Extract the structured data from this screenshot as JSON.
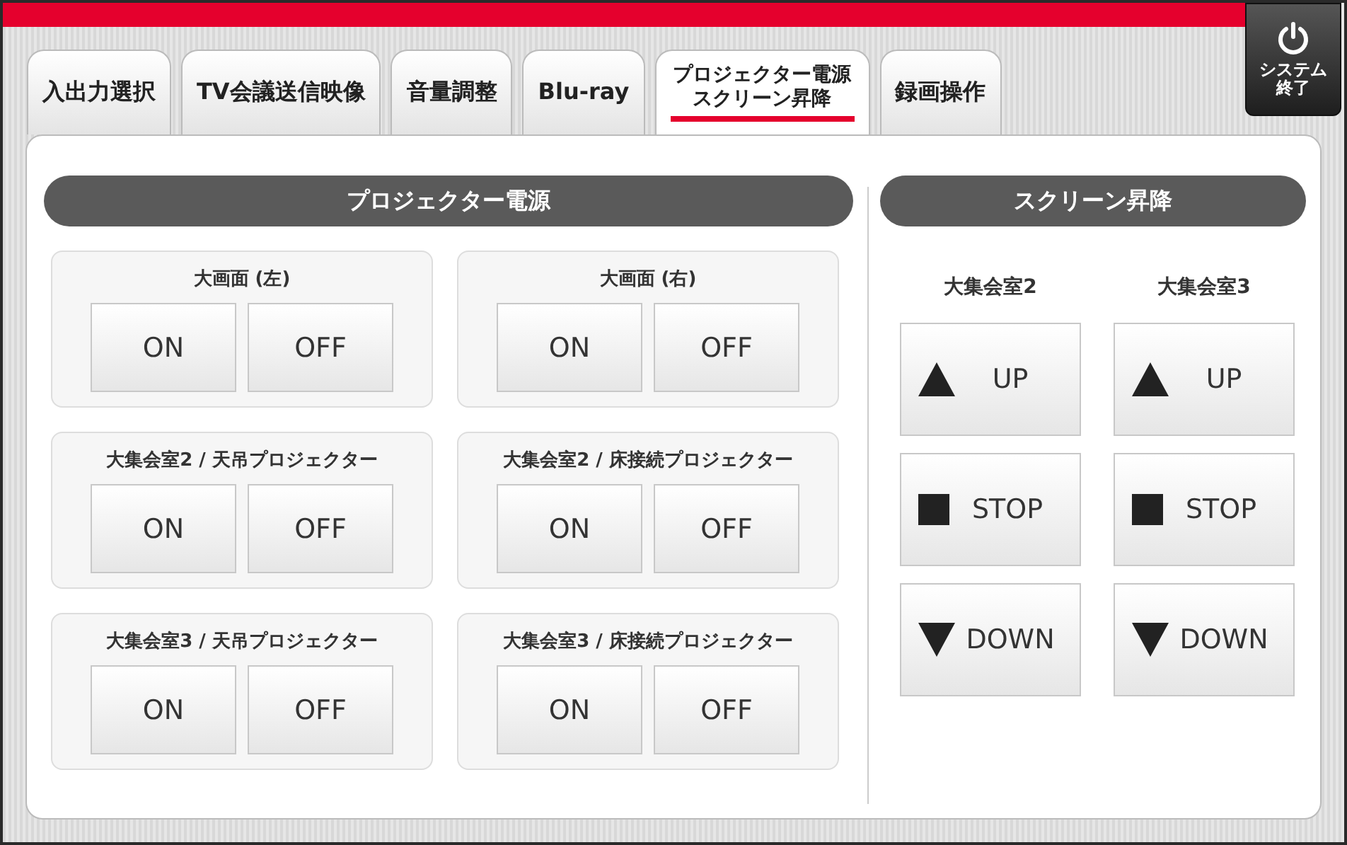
{
  "tabs": [
    {
      "label": "入出力選択",
      "selected": false
    },
    {
      "label": "TV会議送信映像",
      "selected": false
    },
    {
      "label": "音量調整",
      "selected": false
    },
    {
      "label": "Blu-ray",
      "selected": false
    },
    {
      "label": "プロジェクター電源スクリーン昇降",
      "selected": true
    },
    {
      "label": "録画操作",
      "selected": false
    }
  ],
  "system_button": {
    "label": "システム終了"
  },
  "projector_power": {
    "title": "プロジェクター電源",
    "groups": [
      {
        "name": "大画面 (左)",
        "buttons": [
          "ON",
          "OFF"
        ]
      },
      {
        "name": "大画面 (右)",
        "buttons": [
          "ON",
          "OFF"
        ]
      },
      {
        "name": "大集会室2 / 天吊プロジェクター",
        "buttons": [
          "ON",
          "OFF"
        ]
      },
      {
        "name": "大集会室2 / 床接続プロジェクター",
        "buttons": [
          "ON",
          "OFF"
        ]
      },
      {
        "name": "大集会室3 / 天吊プロジェクター",
        "buttons": [
          "ON",
          "OFF"
        ]
      },
      {
        "name": "大集会室3 / 床接続プロジェクター",
        "buttons": [
          "ON",
          "OFF"
        ]
      }
    ]
  },
  "screen": {
    "title": "スクリーン昇降",
    "rooms": [
      {
        "name": "大集会室2",
        "buttons": [
          {
            "kind": "up",
            "label": "UP"
          },
          {
            "kind": "stop",
            "label": "STOP"
          },
          {
            "kind": "down",
            "label": "DOWN"
          }
        ]
      },
      {
        "name": "大集会室3",
        "buttons": [
          {
            "kind": "up",
            "label": "UP"
          },
          {
            "kind": "stop",
            "label": "STOP"
          },
          {
            "kind": "down",
            "label": "DOWN"
          }
        ]
      }
    ]
  }
}
